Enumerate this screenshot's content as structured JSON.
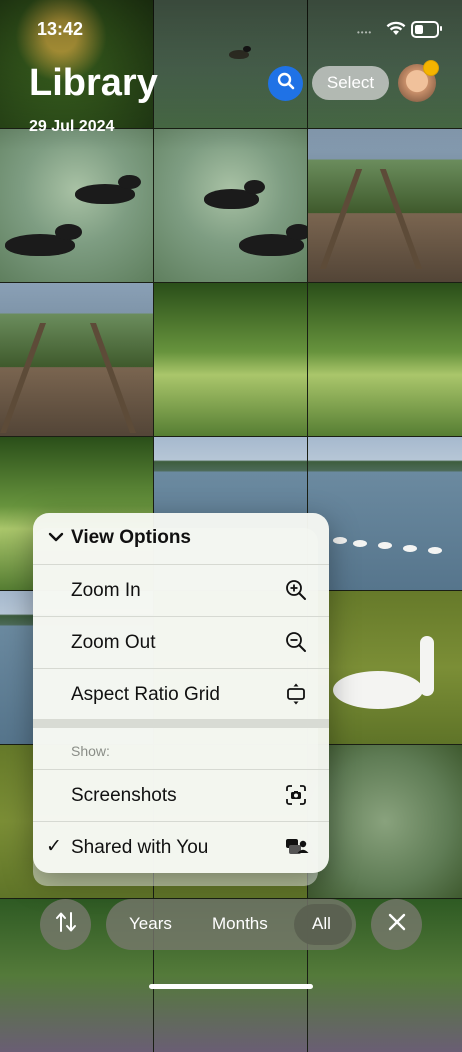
{
  "status": {
    "time": "13:42"
  },
  "header": {
    "title": "Library",
    "date": "29 Jul 2024",
    "select_label": "Select"
  },
  "menu": {
    "title": "View Options",
    "items": [
      {
        "label": "Zoom In",
        "icon": "zoom-in-icon"
      },
      {
        "label": "Zoom Out",
        "icon": "zoom-out-icon"
      },
      {
        "label": "Aspect Ratio Grid",
        "icon": "aspect-ratio-icon"
      }
    ],
    "show_label": "Show:",
    "toggles": [
      {
        "label": "Screenshots",
        "icon": "screenshot-icon",
        "checked": false
      },
      {
        "label": "Shared with You",
        "icon": "shared-with-you-icon",
        "checked": true
      }
    ]
  },
  "bottom_bar": {
    "segments": [
      "Years",
      "Months",
      "All"
    ],
    "selected": "All"
  },
  "colors": {
    "accent": "#1f72e6",
    "badge": "#f5b400"
  }
}
